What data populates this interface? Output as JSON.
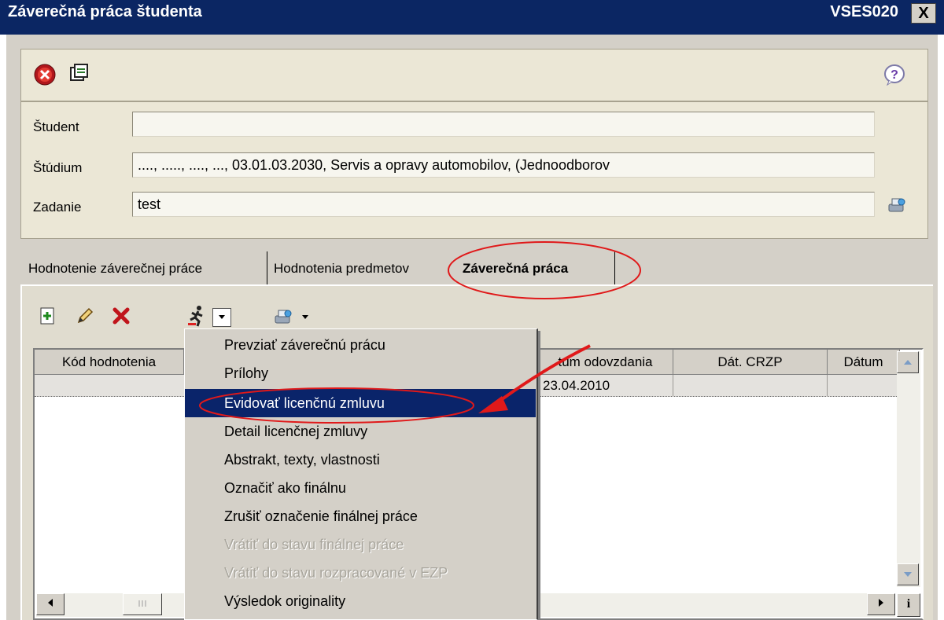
{
  "window": {
    "title": "Záverečná práca študenta",
    "code": "VSES020",
    "close_label": "X"
  },
  "form": {
    "student_label": "Študent",
    "student_value": "",
    "studium_label": "Štúdium",
    "studium_value": "...., ....., ...., ..., 03.01.03.2030, Servis a opravy automobilov, (Jednoodborov",
    "zadanie_label": "Zadanie",
    "zadanie_value": "test"
  },
  "tabs": [
    {
      "label": "Hodnotenie záverečnej práce"
    },
    {
      "label": "Hodnotenia predmetov"
    },
    {
      "label": "Záverečná práca",
      "active": true
    }
  ],
  "grid": {
    "headers": [
      "Kód hodnotenia",
      "tum odovzdania",
      "Dát. CRZP",
      "Dátum"
    ],
    "rows": [
      {
        "datum_odovzdania": "23.04.2010"
      }
    ]
  },
  "menu": {
    "items": [
      {
        "label": "Prevziať záverečnú prácu",
        "state": "enabled"
      },
      {
        "label": "Prílohy",
        "state": "enabled"
      },
      {
        "label": "Evidovať licenčnú zmluvu",
        "state": "selected"
      },
      {
        "label": "Detail licenčnej zmluvy",
        "state": "enabled"
      },
      {
        "label": "Abstrakt, texty, vlastnosti",
        "state": "enabled"
      },
      {
        "label": "Označiť ako finálnu",
        "state": "enabled"
      },
      {
        "label": "Zrušiť označenie finálnej práce",
        "state": "enabled"
      },
      {
        "label": "Vrátiť do stavu finálnej práce",
        "state": "disabled"
      },
      {
        "label": "Vrátiť do stavu rozpracované v EZP",
        "state": "disabled"
      },
      {
        "label": "Výsledok originality",
        "state": "enabled"
      }
    ]
  },
  "scroll": {
    "right_info": "i"
  },
  "icons": [
    "exit-icon",
    "save-all-icon",
    "help-icon",
    "lookup-icon",
    "add-record-icon",
    "edit-pencil-icon",
    "delete-icon",
    "run-actions-icon",
    "dropdown-arrow-icon",
    "print-options-icon"
  ],
  "colors": {
    "title_bar": "#0b2663",
    "selection": "#0a246a",
    "annotation": "#e0191a"
  }
}
